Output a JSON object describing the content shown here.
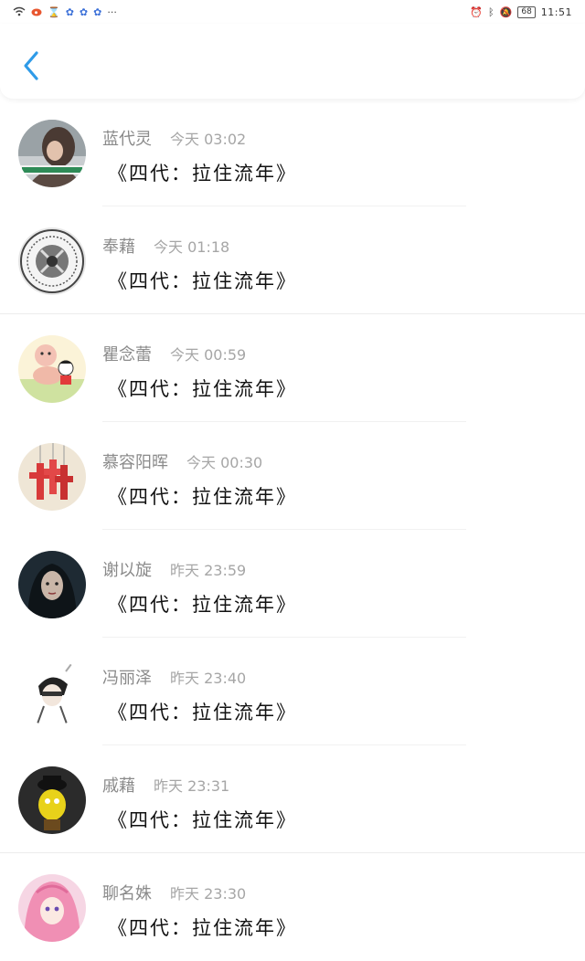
{
  "status_bar": {
    "time": "11:51",
    "battery": "68",
    "more": "···"
  },
  "header": {
    "back_icon": "chevron-left-icon",
    "accent": "#2f9be8"
  },
  "comments": [
    {
      "name": "蓝代灵",
      "time": "今天 03:02",
      "content": "《四代：拉住流年》",
      "avatar": "photo-girl"
    },
    {
      "name": "奉藉",
      "time": "今天 01:18",
      "content": "《四代：拉住流年》",
      "avatar": "emblem"
    },
    {
      "name": "瞿念蕾",
      "time": "今天 00:59",
      "content": "《四代：拉住流年》",
      "avatar": "cartoon"
    },
    {
      "name": "慕容阳晖",
      "time": "今天 00:30",
      "content": "《四代：拉住流年》",
      "avatar": "red-crosses"
    },
    {
      "name": "谢以旋",
      "time": "昨天 23:59",
      "content": "《四代：拉住流年》",
      "avatar": "dark-girl"
    },
    {
      "name": "冯丽泽",
      "time": "昨天 23:40",
      "content": "《四代：拉住流年》",
      "avatar": "sketch-figure"
    },
    {
      "name": "戚藉",
      "time": "昨天 23:31",
      "content": "《四代：拉住流年》",
      "avatar": "yellow-figure"
    },
    {
      "name": "聊名姝",
      "time": "昨天 23:30",
      "content": "《四代：拉住流年》",
      "avatar": "pink-anime"
    }
  ]
}
